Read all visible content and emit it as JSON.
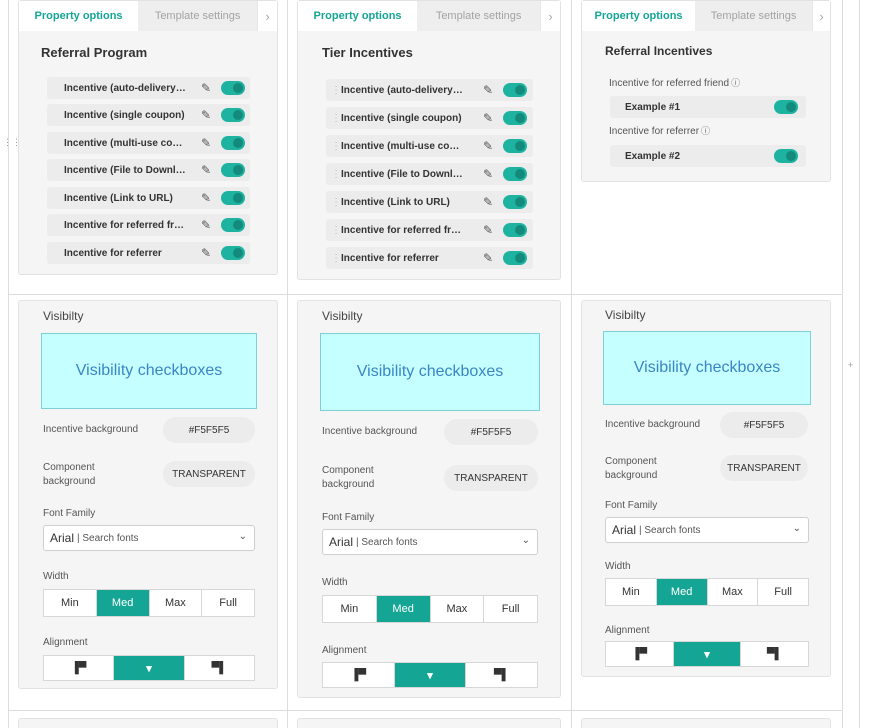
{
  "tabs": {
    "property_options": "Property options",
    "template_settings": "Template settings",
    "next": "›"
  },
  "col1": {
    "title": "Referral Program",
    "items": [
      "Incentive (auto-delivery…",
      "Incentive (single coupon)",
      "Incentive (multi-use co…",
      "Incentive (File to Downl…",
      "Incentive (Link to URL)",
      "Incentive for referred fr…",
      "Incentive for referrer"
    ]
  },
  "col2": {
    "title": "Tier Incentives",
    "items": [
      "Incentive (auto-delivery…",
      "Incentive (single coupon)",
      "Incentive (multi-use co…",
      "Incentive (File to Downl…",
      "Incentive (Link to URL)",
      "Incentive for referred fr…",
      "Incentive for referrer"
    ]
  },
  "col3": {
    "title": "Referral Incentives",
    "friend_label": "Incentive for referred friend",
    "friend_example": "Example #1",
    "referrer_label": "Incentive for referrer",
    "referrer_example": "Example #2"
  },
  "visibility": {
    "title": "Visibilty",
    "box_text": "Visibility checkboxes",
    "incentive_bg_label": "Incentive background",
    "incentive_bg_value": "#F5F5F5",
    "component_bg_label": "Component background",
    "component_bg_value": "TRANSPARENT",
    "font_family_label": "Font Family",
    "font_name": "Arial",
    "font_search": "| Search fonts",
    "width_label": "Width",
    "width_options": [
      "Min",
      "Med",
      "Max",
      "Full"
    ],
    "width_selected": "Med",
    "alignment_label": "Alignment",
    "alignment_selected": "center"
  },
  "colors": {
    "accent": "#15a594",
    "toggle": "#1db3a0",
    "visibility_box": "#c5ffff"
  },
  "icons": [
    "pencil-icon",
    "info-icon",
    "chevron-down-icon",
    "align-left-icon",
    "align-center-icon",
    "align-right-icon",
    "drag-handle-icon"
  ]
}
